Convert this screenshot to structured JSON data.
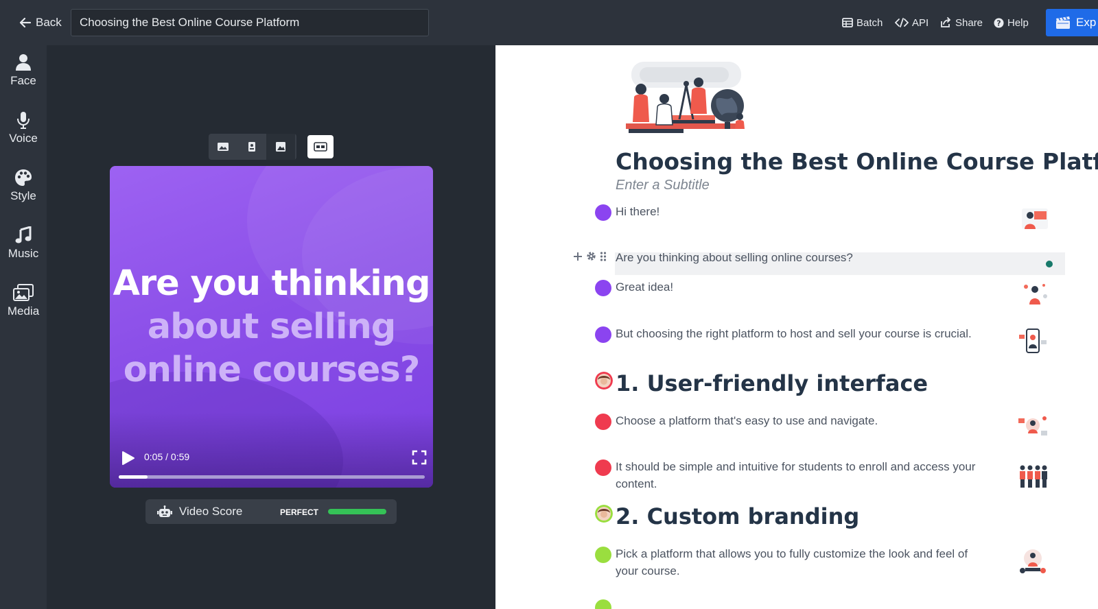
{
  "topbar": {
    "back_label": "Back",
    "title_value": "Choosing the Best Online Course Platform",
    "actions": {
      "batch": "Batch",
      "api": "API",
      "share": "Share",
      "help": "Help"
    },
    "export_label": "Exp"
  },
  "leftnav": {
    "face": "Face",
    "voice": "Voice",
    "style": "Style",
    "music": "Music",
    "media": "Media"
  },
  "video": {
    "headline_line1": "Are you thinking",
    "headline_line2": "about selling",
    "headline_line3": "online courses?",
    "time": "0:05 / 0:59",
    "progress": 0.095
  },
  "score": {
    "label": "Video Score",
    "status": "PERFECT",
    "level": 1.0
  },
  "document": {
    "title": "Choosing the Best Online Course Platf...",
    "subtitle_placeholder": "Enter a Subtitle",
    "lines": {
      "l1": "Hi there!",
      "l2": "Are you thinking about selling online courses?",
      "l3": "Great idea!",
      "l4": "But choosing the right platform to host and sell your course is crucial.",
      "l5": "Choose a platform that's easy to use and navigate.",
      "l6a": "It should be simple and intuitive for students to enroll and access your",
      "l6b": "content.",
      "l7a": "Pick a platform that allows you to fully customize the look and feel of",
      "l7b": "your course."
    },
    "sections": {
      "s1": "1. User-friendly interface",
      "s2": "2. Custom branding"
    }
  },
  "colors": {
    "accent_blue": "#1f6be8",
    "speaker_purple": "#8b44f0",
    "speaker_red": "#ef3b4f",
    "speaker_green": "#9ade3f",
    "score_green": "#35c257"
  }
}
